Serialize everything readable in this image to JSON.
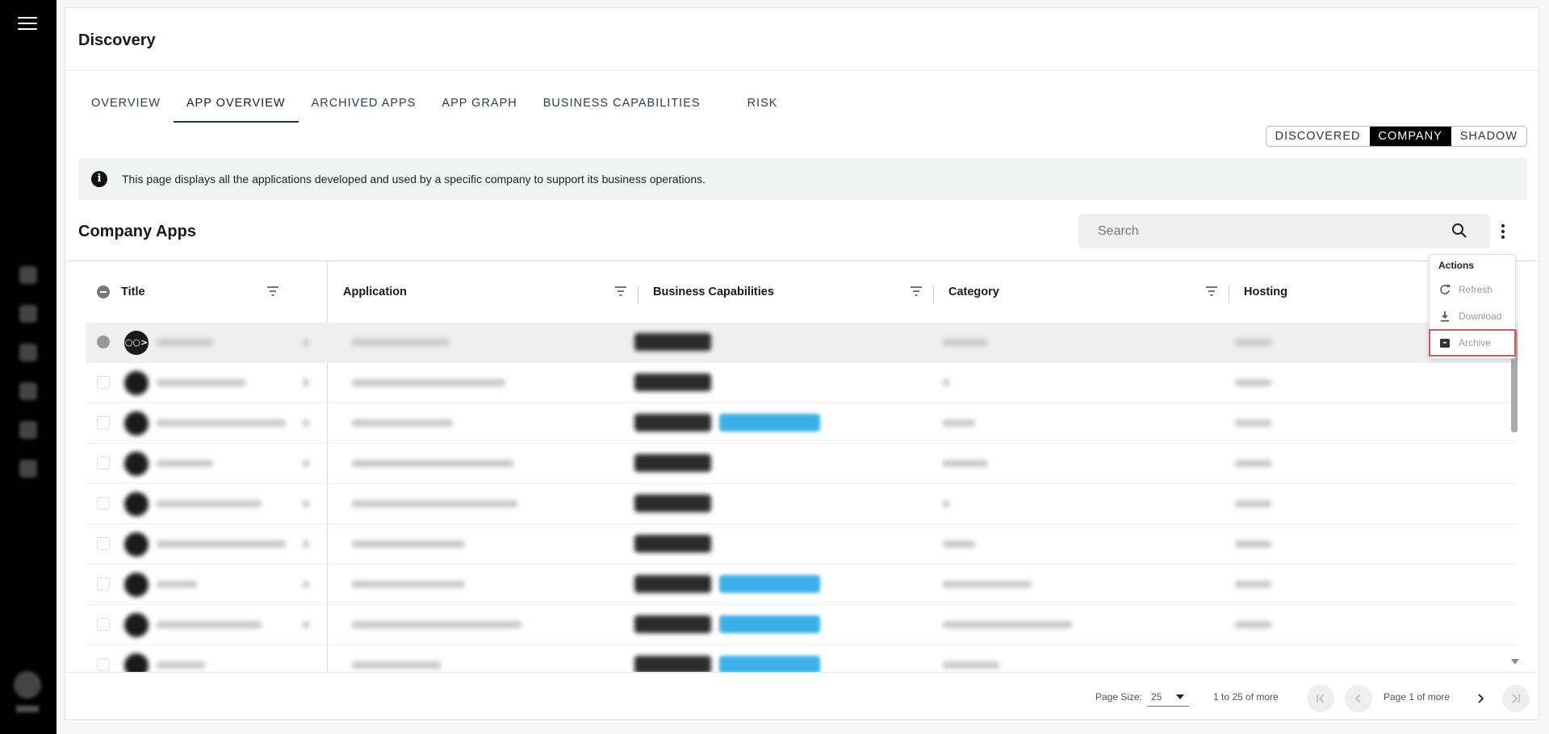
{
  "page": {
    "title": "Discovery"
  },
  "tabs": [
    {
      "label": "OVERVIEW"
    },
    {
      "label": "APP OVERVIEW"
    },
    {
      "label": "ARCHIVED APPS"
    },
    {
      "label": "APP GRAPH"
    },
    {
      "label": "BUSINESS CAPABILITIES"
    },
    {
      "label": "RISK"
    }
  ],
  "active_tab": "APP OVERVIEW",
  "view_toggle": {
    "options": [
      "DISCOVERED",
      "COMPANY",
      "SHADOW"
    ],
    "selected": "COMPANY"
  },
  "info_banner": {
    "text": "This page displays all the applications developed and used by a specific company to support its business operations."
  },
  "section": {
    "title": "Company Apps"
  },
  "search": {
    "placeholder": "Search"
  },
  "table": {
    "columns": [
      "Title",
      "Application",
      "Business Capabilities",
      "Category",
      "Hosting"
    ],
    "first_row_logo": "○○>"
  },
  "actions_menu": {
    "header": "Actions",
    "items": [
      {
        "label": "Refresh",
        "icon": "refresh-icon"
      },
      {
        "label": "Download",
        "icon": "download-icon"
      },
      {
        "label": "Archive",
        "icon": "archive-icon"
      }
    ],
    "highlighted": "Archive"
  },
  "pagination": {
    "page_size_label": "Page Size:",
    "page_size": "25",
    "range_text": "1 to 25 of more",
    "page_text": "Page 1 of more"
  },
  "colors": {
    "accent_pill": "#3bb0e8",
    "highlight_border": "#e0515a",
    "toggle_active": "#000000"
  }
}
